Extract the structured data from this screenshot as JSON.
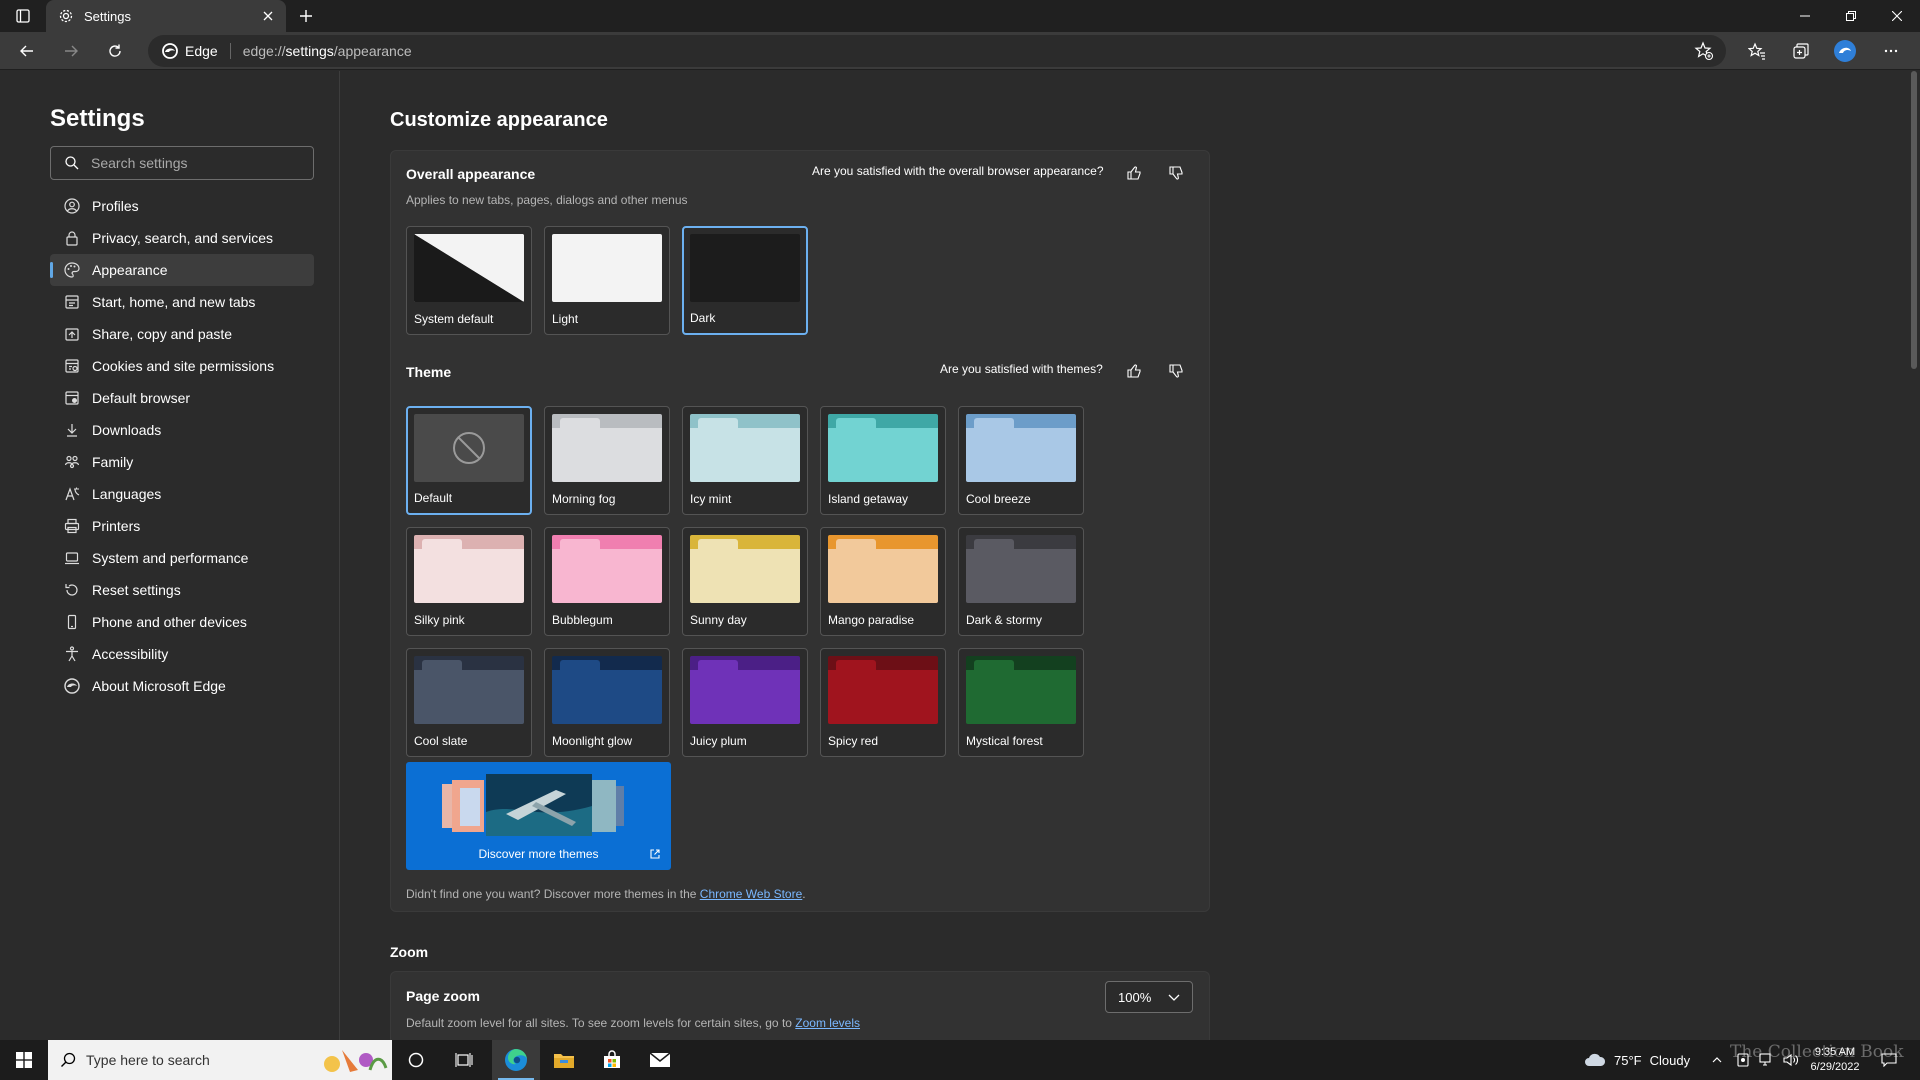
{
  "browser": {
    "tab_title": "Settings",
    "address_site": "Edge",
    "address_url_prefix": "edge://",
    "address_url_main": "settings",
    "address_url_path": "/appearance"
  },
  "sidebar": {
    "title": "Settings",
    "search_placeholder": "Search settings",
    "items": [
      {
        "label": "Profiles",
        "icon": "profile-icon"
      },
      {
        "label": "Privacy, search, and services",
        "icon": "lock-icon"
      },
      {
        "label": "Appearance",
        "icon": "palette-icon",
        "active": true
      },
      {
        "label": "Start, home, and new tabs",
        "icon": "home-icon"
      },
      {
        "label": "Share, copy and paste",
        "icon": "share-icon"
      },
      {
        "label": "Cookies and site permissions",
        "icon": "cookie-icon"
      },
      {
        "label": "Default browser",
        "icon": "browser-icon"
      },
      {
        "label": "Downloads",
        "icon": "download-icon"
      },
      {
        "label": "Family",
        "icon": "family-icon"
      },
      {
        "label": "Languages",
        "icon": "language-icon"
      },
      {
        "label": "Printers",
        "icon": "printer-icon"
      },
      {
        "label": "System and performance",
        "icon": "laptop-icon"
      },
      {
        "label": "Reset settings",
        "icon": "reset-icon"
      },
      {
        "label": "Phone and other devices",
        "icon": "phone-icon"
      },
      {
        "label": "Accessibility",
        "icon": "accessibility-icon"
      },
      {
        "label": "About Microsoft Edge",
        "icon": "edge-icon"
      }
    ]
  },
  "main": {
    "title": "Customize appearance",
    "overall": {
      "title": "Overall appearance",
      "subtitle": "Applies to new tabs, pages, dialogs and other menus",
      "feedback": "Are you satisfied with the overall browser appearance?",
      "options": [
        {
          "label": "System default"
        },
        {
          "label": "Light"
        },
        {
          "label": "Dark",
          "selected": true
        }
      ]
    },
    "theme": {
      "title": "Theme",
      "feedback": "Are you satisfied with themes?",
      "options": [
        {
          "label": "Default",
          "top": "#4a4a4a",
          "tab": "#4a4a4a",
          "body": "#4a4a4a",
          "selected": true
        },
        {
          "label": "Morning fog",
          "top": "#b9bcc0",
          "tab": "#dcdde0",
          "body": "#dcdde0"
        },
        {
          "label": "Icy mint",
          "top": "#8fc2c9",
          "tab": "#c7e2e6",
          "body": "#c7e2e6"
        },
        {
          "label": "Island getaway",
          "top": "#3fa8a6",
          "tab": "#72d3d2",
          "body": "#72d3d2"
        },
        {
          "label": "Cool breeze",
          "top": "#6c9dc9",
          "tab": "#a9c8e6",
          "body": "#a9c8e6"
        },
        {
          "label": "Silky pink",
          "top": "#dcb1b1",
          "tab": "#f3e0e0",
          "body": "#f3e0e0"
        },
        {
          "label": "Bubblegum",
          "top": "#f07fb0",
          "tab": "#f8b6d0",
          "body": "#f8b6d0"
        },
        {
          "label": "Sunny day",
          "top": "#d9b53a",
          "tab": "#eee2b4",
          "body": "#eee2b4"
        },
        {
          "label": "Mango paradise",
          "top": "#e8962e",
          "tab": "#f2c99b",
          "body": "#f2c99b"
        },
        {
          "label": "Dark & stormy",
          "top": "#3b3b40",
          "tab": "#5a5a62",
          "body": "#5a5a62"
        },
        {
          "label": "Cool slate",
          "top": "#2a3242",
          "tab": "#4a5568",
          "body": "#4a5568"
        },
        {
          "label": "Moonlight glow",
          "top": "#122a4d",
          "tab": "#1e4a85",
          "body": "#1e4a85"
        },
        {
          "label": "Juicy plum",
          "top": "#4b1f86",
          "tab": "#6f32b8",
          "body": "#6f32b8"
        },
        {
          "label": "Spicy red",
          "top": "#6d0f16",
          "tab": "#a0141e",
          "body": "#a0141e"
        },
        {
          "label": "Mystical forest",
          "top": "#13401f",
          "tab": "#1f6a32",
          "body": "#1f6a32"
        }
      ]
    },
    "discover_label": "Discover more themes",
    "hint_text": "Didn't find one you want? Discover more themes in the",
    "hint_link": "Chrome Web Store",
    "hint_end": ".",
    "zoom": {
      "section_title": "Zoom",
      "page_zoom_title": "Page zoom",
      "page_zoom_sub": "Default zoom level for all sites. To see zoom levels for certain sites, go to",
      "page_zoom_link": "Zoom levels",
      "value": "100%"
    }
  },
  "taskbar": {
    "search_placeholder": "Type here to search",
    "temperature": "75°F",
    "weather": "Cloudy",
    "time": "9:35 AM",
    "date": "6/29/2022"
  },
  "watermark": "The Collection Book",
  "colors": {
    "accent": "#6cb0f0",
    "link": "#7ab8ff",
    "discover_bg": "#0b6fd4"
  }
}
